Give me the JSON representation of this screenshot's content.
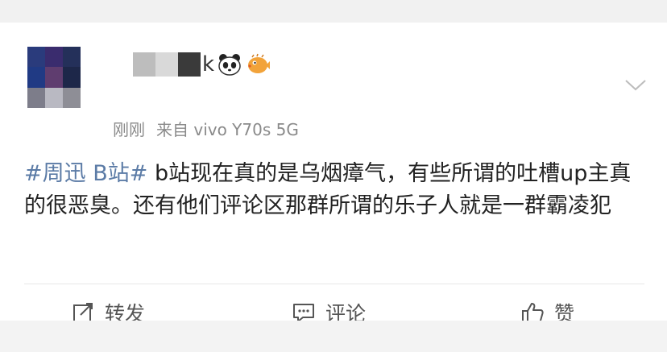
{
  "post": {
    "username_tail": "k",
    "time": "刚刚",
    "source": "来自 vivo Y70s 5G",
    "topic": "#周迅 B站#",
    "text": " b站现在真的是乌烟瘴气，有些所谓的吐槽up主真的很恶臭。还有他们评论区那群所谓的乐子人就是一群霸凌犯"
  },
  "actions": {
    "repost_label": "转发",
    "comment_label": "评论",
    "like_label": "赞"
  },
  "icons": {
    "repost": "edit-repost-icon",
    "comment": "comment-icon",
    "like": "thumbs-up-icon",
    "more": "chevron-down-icon",
    "emoji_1": "panda-icon",
    "emoji_2": "pufferfish-icon"
  },
  "colors": {
    "topic_link": "#5b7ba6",
    "meta_text": "#8a8a8a",
    "body_text": "#222222"
  }
}
